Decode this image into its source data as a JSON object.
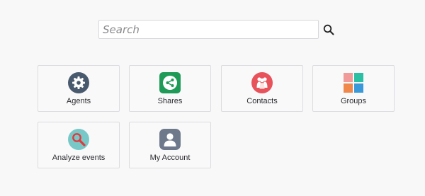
{
  "search": {
    "placeholder": "Search",
    "value": ""
  },
  "tiles": [
    {
      "label": "Agents",
      "icon": "gear-icon",
      "color": "#4a5a6e"
    },
    {
      "label": "Shares",
      "icon": "share-icon",
      "color": "#1e9b57"
    },
    {
      "label": "Contacts",
      "icon": "contacts-icon",
      "color": "#e8525a"
    },
    {
      "label": "Groups",
      "icon": "groups-icon",
      "colors": [
        "#f19a9a",
        "#2bbfa4",
        "#f0884c",
        "#3a9ad9"
      ]
    },
    {
      "label": "Analyze events",
      "icon": "magnifier-icon",
      "color": "#79c8c8"
    },
    {
      "label": "My Account",
      "icon": "user-icon",
      "color": "#6e7a8c"
    }
  ]
}
